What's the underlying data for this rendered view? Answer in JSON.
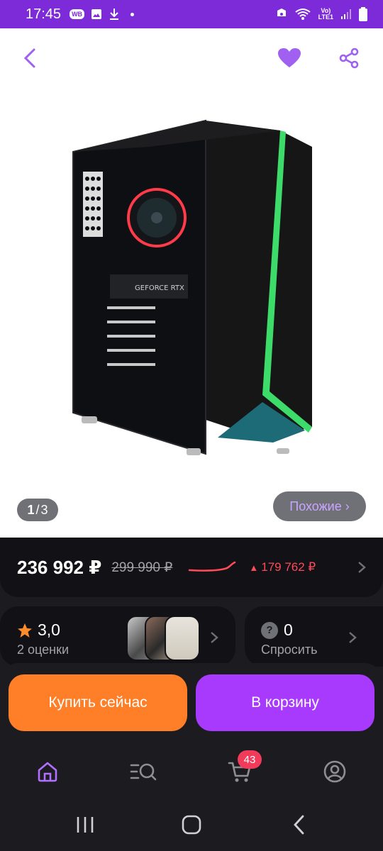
{
  "statusbar": {
    "time": "17:45",
    "wb_badge": "WB",
    "network_top": "Vo)",
    "network_bottom": "LTE1"
  },
  "gallery": {
    "current": "1",
    "separator": "/",
    "total": "3",
    "similar_label": "Похожие ›",
    "product_graphic_label": "GEFORCE RTX"
  },
  "price": {
    "current": "236 992 ₽",
    "old": "299 990 ₽",
    "delta": "179 762 ₽",
    "delta_color": "#ff4a5b"
  },
  "rating": {
    "value": "3,0",
    "count_label": "2 оценки"
  },
  "questions": {
    "count": "0",
    "label": "Спросить"
  },
  "actions": {
    "buy_now": "Купить сейчас",
    "add_to_cart": "В корзину"
  },
  "tabbar": {
    "cart_badge": "43"
  },
  "colors": {
    "brand": "#7d2bd9",
    "accent_purple": "#a73afd",
    "buy_orange": "#ff7e28",
    "badge_red": "#f23a5a"
  }
}
